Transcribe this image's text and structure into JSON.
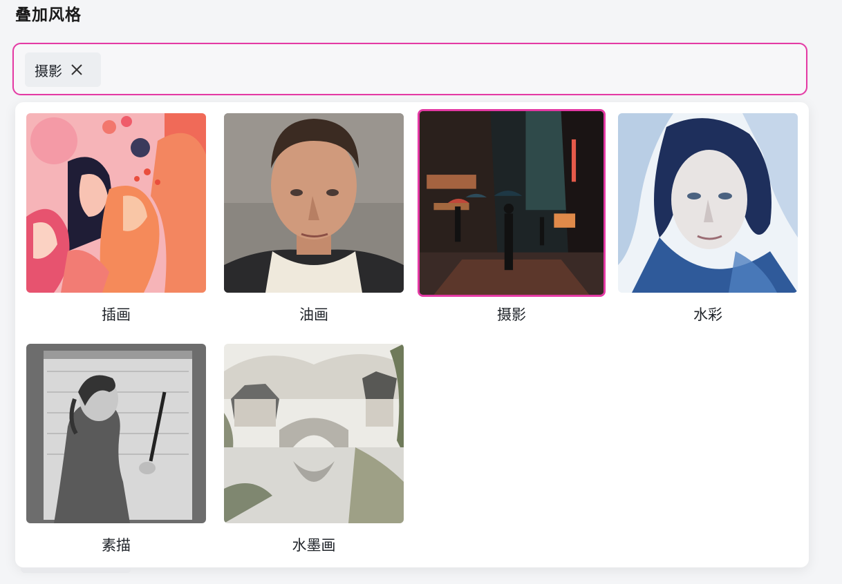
{
  "section": {
    "title": "叠加风格"
  },
  "selected_tags": [
    {
      "label": "摄影",
      "close_icon": "close-icon"
    }
  ],
  "styles": [
    {
      "label": "插画",
      "image": "illustration-women-faces",
      "selected": false
    },
    {
      "label": "油画",
      "image": "oil-painting-man-portrait",
      "selected": false
    },
    {
      "label": "摄影",
      "image": "rainy-city-street-photo",
      "selected": true
    },
    {
      "label": "水彩",
      "image": "watercolor-woman-portrait",
      "selected": false
    },
    {
      "label": "素描",
      "image": "pencil-sketch-girl",
      "selected": false
    },
    {
      "label": "水墨画",
      "image": "ink-wash-bridge-village",
      "selected": false
    }
  ],
  "colors": {
    "accent": "#e43aa4"
  }
}
